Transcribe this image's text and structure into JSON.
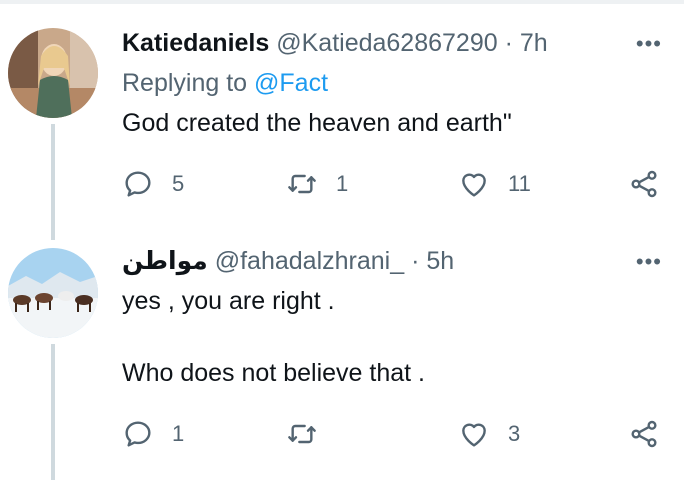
{
  "tweets": [
    {
      "name": "Katiedaniels",
      "handle": "@Katieda62867290",
      "dot": "·",
      "time": "7h",
      "replying_prefix": "Replying to ",
      "replying_mention": "@Fact",
      "lines": [
        "God created the heaven and earth\""
      ],
      "actions": {
        "replies": "5",
        "retweets": "1",
        "likes": "11"
      }
    },
    {
      "name": "مواطن",
      "handle": "@fahadalzhrani_",
      "dot": "·",
      "time": "5h",
      "lines": [
        "yes , you are right .",
        "Who does not believe that ."
      ],
      "actions": {
        "replies": "1",
        "retweets": "",
        "likes": "3"
      }
    }
  ],
  "more_symbol": "•••",
  "colors": {
    "text": "#0f1419",
    "secondary": "#536471",
    "link": "#1d9bf0",
    "thread_line": "#cfd9de"
  }
}
